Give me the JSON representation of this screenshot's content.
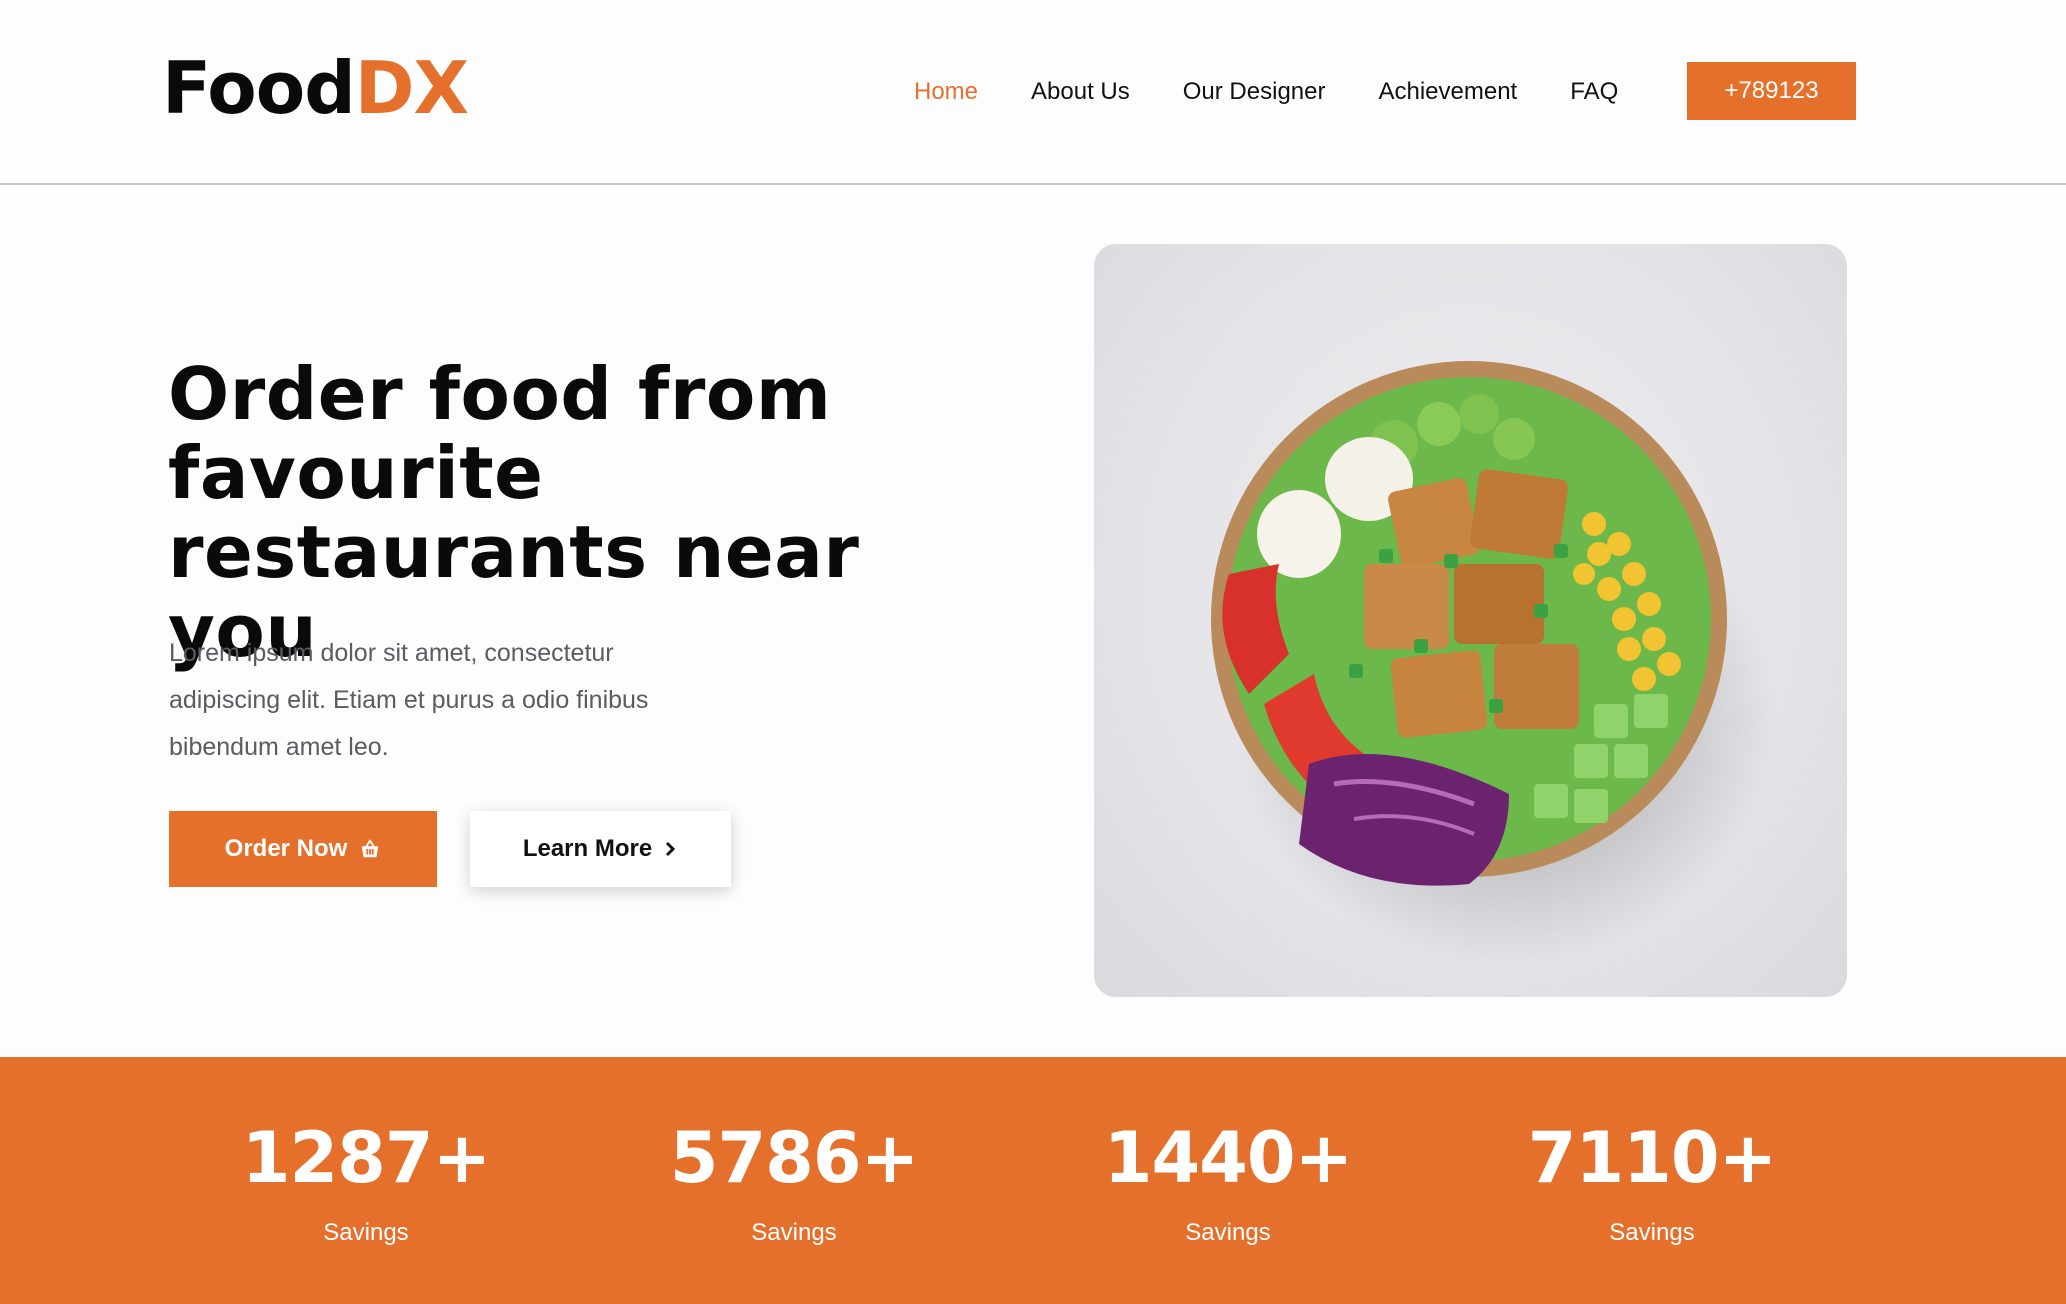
{
  "brand": {
    "name_part1": "Food",
    "name_part2": "DX"
  },
  "nav": {
    "items": [
      {
        "label": "Home",
        "active": true
      },
      {
        "label": "About Us"
      },
      {
        "label": "Our Designer"
      },
      {
        "label": "Achievement"
      },
      {
        "label": "FAQ"
      }
    ],
    "phone": "+789123"
  },
  "hero": {
    "title": "Order food from favourite restaurants near you",
    "description": "Lorem ipsum dolor sit amet, consectetur adipiscing elit. Etiam et purus a odio finibus bibendum amet leo.",
    "order_button": "Order Now",
    "order_icon": "basket-icon",
    "learn_button": "Learn More",
    "learn_icon": "chevron-right-icon",
    "image_subject": "salad bowl"
  },
  "stats": [
    {
      "value": "1287+",
      "label": "Savings"
    },
    {
      "value": "5786+",
      "label": "Savings"
    },
    {
      "value": "1440+",
      "label": "Savings"
    },
    {
      "value": "7110+",
      "label": "Savings"
    }
  ],
  "colors": {
    "accent": "#e5702c",
    "text": "#0a0a0a",
    "muted": "#5b5b60"
  }
}
